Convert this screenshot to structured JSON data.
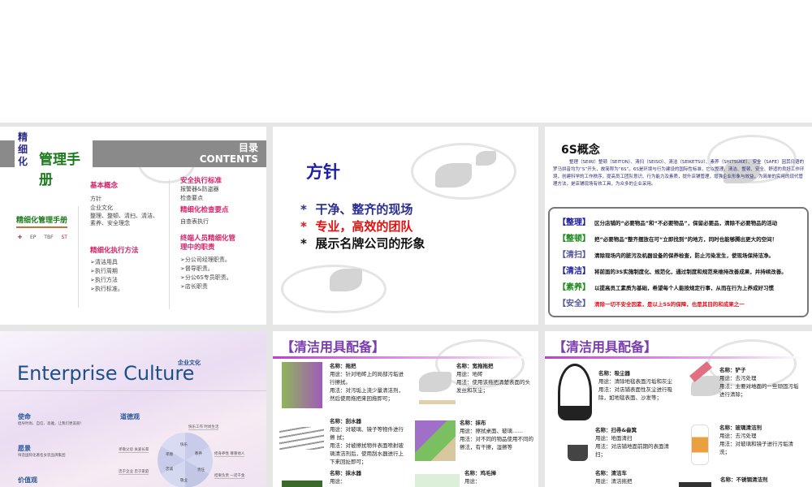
{
  "slides": [
    {
      "title_vertical": "精细化",
      "title_main": "管理手册",
      "contents_cn": "目录",
      "contents_en": "CONTENTS",
      "logo_text": "精细化管理手册",
      "brands": [
        "EP",
        "TBF",
        "ST"
      ],
      "col1": {
        "h1": "基本概念",
        "items1": [
          "方针",
          "企业文化",
          "整理、整顿、清扫、清洁、素养、安全理念"
        ],
        "h2": "精细化执行方法",
        "items2": [
          "➢清洁用具",
          "➢执行周期",
          "➢执行方法",
          "➢执行标准。"
        ]
      },
      "col2": {
        "h1": "安全执行标准",
        "items1": [
          "报警器&防盗器",
          "检查要点"
        ],
        "h2": "精细化检查要点",
        "items2": [
          "自查表执行"
        ],
        "h3": "终端人员精细化管理中的职责",
        "items3": [
          "➢分公司经理职责。",
          "➢督导职责。",
          "➢分公6S专员职责。",
          "➢店长职责"
        ]
      }
    },
    {
      "title": "方针",
      "bullets": [
        {
          "star": "*",
          "text": "干净、整齐的现场",
          "color": "#2b2f8f"
        },
        {
          "star": "*",
          "text": "专业，高效的团队",
          "color": "#e01010"
        },
        {
          "star": "*",
          "text": "展示名牌公司的形象",
          "color": "#111111"
        }
      ]
    },
    {
      "title": "6S概念",
      "intro": "整理（SEIRI）整顿（SEITON）、清扫（SEISO）、清洁（SEIKETSU）、素养（SHITSUKE）、安全（SAFE）因其日语的罗马拼音均为“S”开头，故简称为“6S”。6S是环境与行为建设的国际性标准，它以整理、清洁、整顿、安全、舒适的良好工作环境，创建科学的工作秩序，提高员工团队意识、行为能力及素质，提升店铺管理，增强企业形象与效益，为简单的实用的现代管理方法，是店铺现场有效工具，为众多的企业采用。",
      "rows": [
        {
          "key": "【整理】",
          "color": "#1a1aa0",
          "text": "区分店铺的“必要物品”和“不必要物品”，保留必要品，清除不必要物品的活动"
        },
        {
          "key": "【整顿】",
          "color": "#1a8a1a",
          "text": "把“必要物品”整齐摆放在可“立即找到”的地方，同时也能够腾出更大的空间！"
        },
        {
          "key": "【清扫】",
          "color": "#555599",
          "text": "清除现场内的脏污及机器设备的保养检查，防止污染发生，使现场保持洁净。"
        },
        {
          "key": "【清洁】",
          "color": "#1a1aa0",
          "text": "将前面的3S实施制度化、规范化，通过制度和规范来维持改善成果，并持续改善。"
        },
        {
          "key": "【素养】",
          "color": "#1a8a1a",
          "text": "以提高员工素质为基础，希望每个人能按规定行事，从而在行为上养成好习惯"
        },
        {
          "key": "【安全】",
          "color": "#555599",
          "text": "清除一切不安全因素，是以上5S的保障，也是其目的和成果之一"
        }
      ]
    },
    {
      "title_en": "Enterprise Culture",
      "title_cn": "企业文化",
      "mission": {
        "h": "使命",
        "t": "倡导时尚、自信、高雅，让我们更美丽!"
      },
      "vision": {
        "h": "愿景",
        "t": "缔造国际化著名女装品牌集团"
      },
      "values": {
        "h": "价值观"
      },
      "ethics": {
        "h": "道德观",
        "segments": [
          "快乐",
          "教养",
          "责任",
          "敬业",
          "忠诚",
          "孝顺"
        ],
        "labels": [
          "快乐工作 时尚生活",
          "修身养性 尊重他人",
          "结果负责 一诺千金",
          "孝敬父母 关爱长辈",
          "忠于企业 忠于家庭"
        ]
      }
    },
    {
      "title": "【清洁用具配备】",
      "items": [
        {
          "name": "名称：拖把",
          "use": "用途：针对地砖上的局部污垢进行擦拭。",
          "method": "用法：对污垢上流少量清洁剂，然后使用拖把来回拖即可；"
        },
        {
          "name": "名称：宽拖拖把",
          "use": "用途：地砖",
          "method": "用法：使用该拖把清楚表面的头发丝和灰尘；"
        },
        {
          "name": "名称：刮水器",
          "use": "用途：对玻璃、镜子等物件进行擦 拭；",
          "method": "用法：对被擦拭物件表面喷射玻璃清洁剂后，使用刮水器进行上下来回扯即可；"
        },
        {
          "name": "名称：抹布",
          "use": "用途：擦拭桌面、玻璃……",
          "method": "用法：对不同的物品使用不同的擦法，有干擦，湿擦等"
        },
        {
          "name": "名称：抹水器",
          "use": "用途：",
          "method": ""
        },
        {
          "name": "名称：鸡毛掸",
          "use": "用途：",
          "method": ""
        }
      ]
    },
    {
      "title": "【清洁用具配备】",
      "items": [
        {
          "name": "名称：吸尘器",
          "use": "用途：清除地毯表面污垢和灰尘",
          "method": "用法：对店铺表面性灰尘进行吸除，如地毯表面、沙发等；"
        },
        {
          "name": "名称：铲子",
          "use": "用途：去污处理",
          "method": "用法：主要对地面的一些顽固污垢进行清除；"
        },
        {
          "name": "名称：扫帚&畚箕",
          "use": "用途：地面清扫",
          "method": "用法：对店铺地面前期的表面清扫；"
        },
        {
          "name": "名称：玻璃清洁剂",
          "use": "用途：去污处理",
          "method": "用法：对玻璃和镜子进行污垢清洗；"
        },
        {
          "name": "名称：清洁车",
          "use": "用途：清洁拖把",
          "method": ""
        },
        {
          "name": "名称：不锈钢清洁剂",
          "use": "",
          "method": ""
        }
      ]
    }
  ]
}
